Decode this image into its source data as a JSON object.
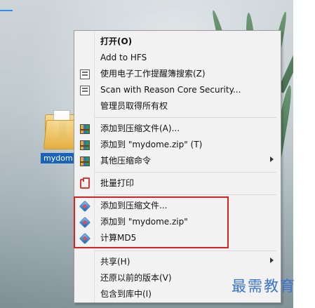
{
  "desktop": {
    "icon_label": "mydom"
  },
  "menu": {
    "items": [
      {
        "label": "打开(O)",
        "icon": "",
        "bold": true
      },
      {
        "label": "Add to HFS",
        "icon": ""
      },
      {
        "label": "使用电子工作提醒簿搜索(Z)",
        "icon": "document-search-icon"
      },
      {
        "label": "Scan with Reason Core Security...",
        "icon": "document-scan-icon"
      },
      {
        "label": "管理员取得所有权",
        "icon": ""
      },
      {
        "label": "添加到压缩文件(A)...",
        "icon": "winrar-icon"
      },
      {
        "label": "添加到 \"mydome.zip\" (T)",
        "icon": "winrar-icon"
      },
      {
        "label": "其他压缩命令",
        "icon": "winrar-icon",
        "submenu": true
      },
      {
        "label": "批量打印",
        "icon": "print-icon"
      },
      {
        "label": "添加到压缩文件...",
        "icon": "cube-icon"
      },
      {
        "label": "添加到 \"mydome.zip\"",
        "icon": "cube-icon"
      },
      {
        "label": "计算MD5",
        "icon": "cube-icon"
      },
      {
        "label": "共享(H)",
        "icon": "",
        "submenu": true
      },
      {
        "label": "还原以前的版本(V)",
        "icon": ""
      },
      {
        "label": "包含到库中(I)",
        "icon": ""
      }
    ]
  },
  "watermark": {
    "text": "最需教育"
  },
  "colors": {
    "highlight": "#d92121",
    "selection": "#1c62b8",
    "accent": "#2e8ef1"
  }
}
